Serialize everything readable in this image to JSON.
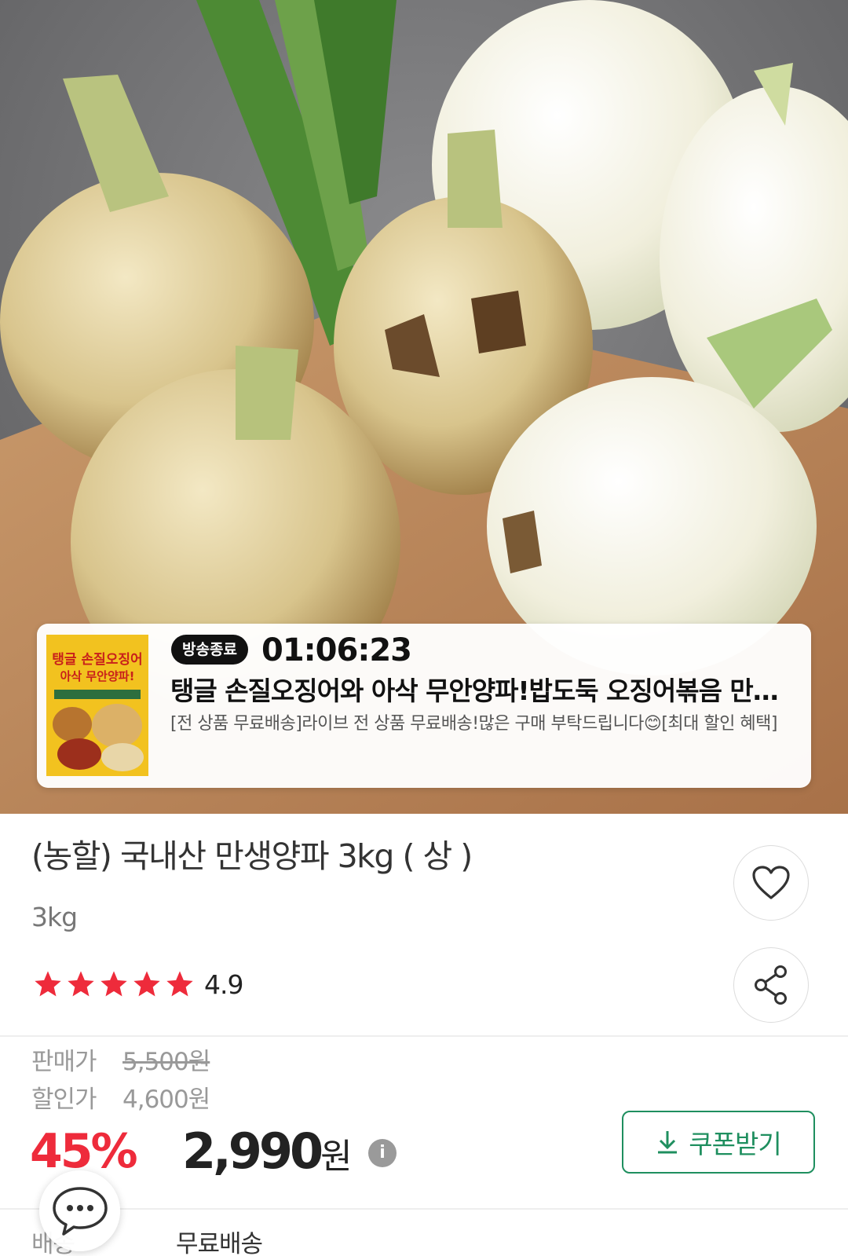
{
  "live": {
    "badge": "방송종료",
    "time": "01:06:23",
    "title": "탱글 손질오징어와 아삭 무안양파!밥도둑 오징어볶음 만들기",
    "description": "[전 상품 무료배송]라이브 전 상품 무료배송!많은 구매 부탁드립니다😊[최대 할인 혜택]",
    "thumbnail": {
      "line1": "탱글 손질오징어",
      "line2": "아삭 무안양파!"
    }
  },
  "product": {
    "title": "(농할) 국내산 만생양파 3kg ( 상 )",
    "weight": "3kg",
    "rating": 4.9,
    "rating_display": "4.9",
    "stars_total": 5
  },
  "price": {
    "sale_label": "판매가",
    "sale_value": "5,500원",
    "discount_label": "할인가",
    "discount_value": "4,600원",
    "discount_rate": "45%",
    "final_amount": "2,990",
    "final_unit": "원",
    "info_icon": "i"
  },
  "coupon": {
    "label": "쿠폰받기"
  },
  "shipping": {
    "label": "배송",
    "value": "무료배송"
  },
  "icons": {
    "wish": "heart-icon",
    "share": "share-icon",
    "coupon": "download-icon",
    "chat": "chat-bubble-icon",
    "info": "info-icon"
  },
  "colors": {
    "discount_red": "#ee2b3b",
    "star_red": "#ee2b3b",
    "coupon_green": "#1f8f5f"
  }
}
